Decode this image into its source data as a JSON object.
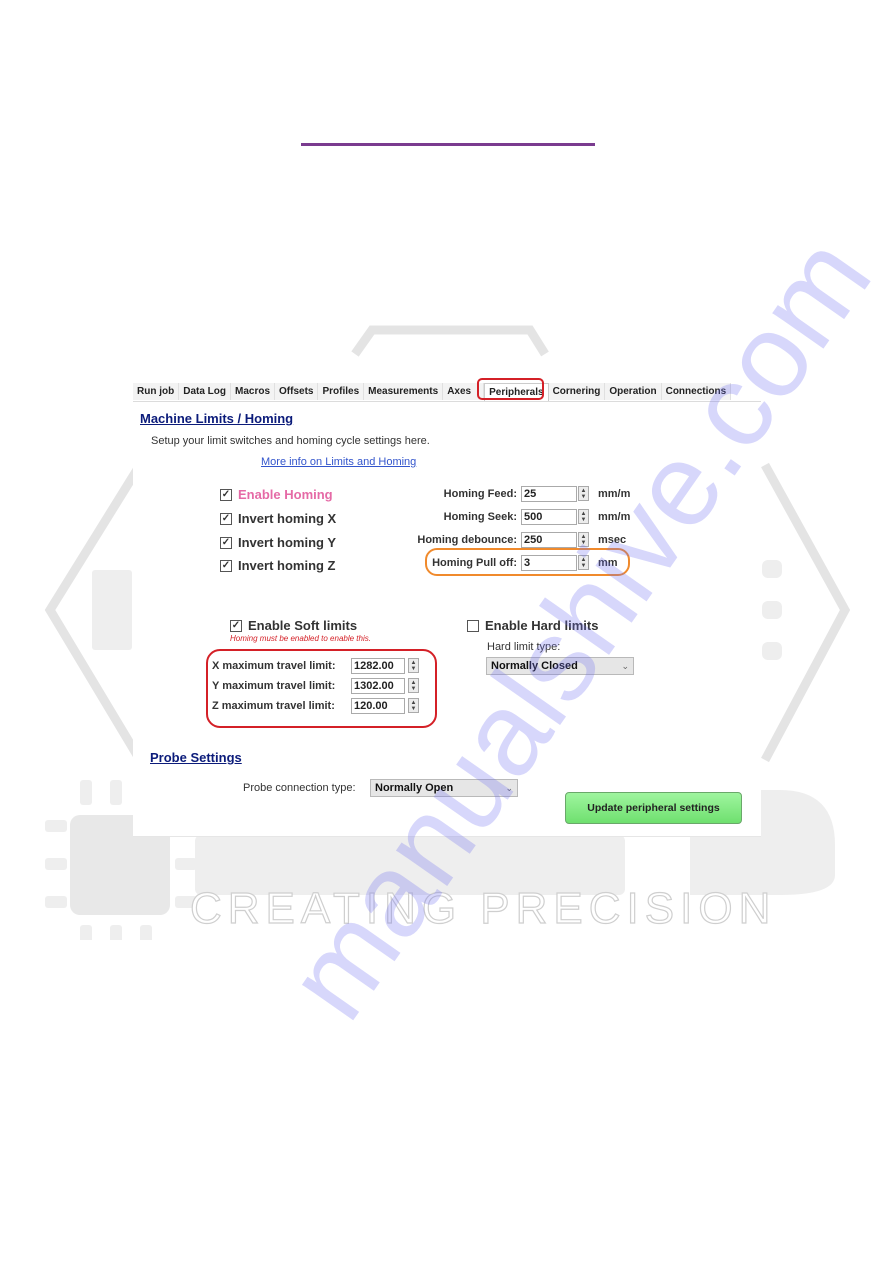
{
  "tabs": [
    {
      "label": "Run job",
      "active": false
    },
    {
      "label": "Data Log",
      "active": false
    },
    {
      "label": "Macros",
      "active": false
    },
    {
      "label": "Offsets",
      "active": false
    },
    {
      "label": "Profiles",
      "active": false
    },
    {
      "label": "Measurements",
      "active": false
    },
    {
      "label": "Axes",
      "active": false
    },
    {
      "label": "Peripherals",
      "active": true
    },
    {
      "label": "Cornering",
      "active": false
    },
    {
      "label": "Operation",
      "active": false
    },
    {
      "label": "Connections",
      "active": false
    }
  ],
  "machine_limits": {
    "title": "Machine Limits / Homing",
    "description": "Setup your limit switches and homing cycle settings here.",
    "info_link": "More info on Limits and Homing",
    "checkboxes": [
      {
        "label": "Enable Homing",
        "checked": true
      },
      {
        "label": "Invert homing X",
        "checked": true
      },
      {
        "label": "Invert homing Y",
        "checked": true
      },
      {
        "label": "Invert homing Z",
        "checked": true
      }
    ],
    "homing_fields": [
      {
        "label": "Homing Feed:",
        "value": "25",
        "unit": "mm/m"
      },
      {
        "label": "Homing Seek:",
        "value": "500",
        "unit": "mm/m"
      },
      {
        "label": "Homing debounce:",
        "value": "250",
        "unit": "msec"
      },
      {
        "label": "Homing Pull off:",
        "value": "3",
        "unit": "mm"
      }
    ],
    "soft_limits": {
      "label": "Enable Soft limits",
      "checked": true,
      "note": "Homing must be enabled to enable this.",
      "fields": [
        {
          "label": "X maximum travel limit:",
          "value": "1282.00"
        },
        {
          "label": "Y maximum travel limit:",
          "value": "1302.00"
        },
        {
          "label": "Z maximum travel limit:",
          "value": "120.00"
        }
      ]
    },
    "hard_limits": {
      "label": "Enable Hard limits",
      "checked": false,
      "type_label": "Hard limit type:",
      "type_value": "Normally Closed"
    }
  },
  "probe": {
    "title": "Probe Settings",
    "connection_label": "Probe connection type:",
    "connection_value": "Normally Open"
  },
  "update_button": "Update peripheral settings",
  "icons": {
    "checked": "☑",
    "unchecked": "☐",
    "spin_up": "▲",
    "spin_down": "▼",
    "dropdown": "⌄"
  },
  "background": {
    "tagline": "CREATING PRECISION",
    "watermark": "manualshive.com"
  },
  "colors": {
    "header_rule": "#7a3b8f",
    "highlight_red": "#d42027",
    "highlight_orange": "#f08a2c",
    "section_title": "#0b1b7a",
    "enable_homing": "#e56aa6",
    "update_button": "#7ee87e"
  }
}
